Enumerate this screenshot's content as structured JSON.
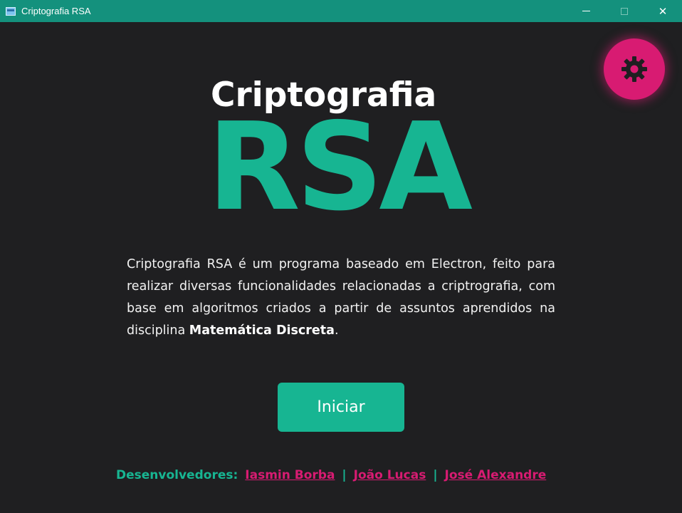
{
  "window": {
    "title": "Criptografia RSA",
    "app_icon": "folder-window-icon",
    "controls": [
      "minimize-icon",
      "maximize-icon",
      "close-icon"
    ],
    "close_glyph": "✕"
  },
  "settings": {
    "icon": "gear-icon",
    "color": "#d81b72"
  },
  "hero": {
    "title_small": "Criptografia",
    "title_big": "RSA",
    "accent_color": "#17b592"
  },
  "description": {
    "text_before": "Criptografia RSA é um programa baseado em Electron, feito para realizar diversas funcionalidades relacionadas a criptrografia, com base em algoritmos criados a partir de assuntos aprendidos na disciplina ",
    "bold": "Matemática Discreta",
    "text_after": "."
  },
  "start_button": {
    "label": "Iniciar"
  },
  "footer": {
    "label": "Desenvolvedores:",
    "separator": "|",
    "developers": [
      "Iasmin Borba",
      "João Lucas",
      "José Alexandre"
    ]
  }
}
